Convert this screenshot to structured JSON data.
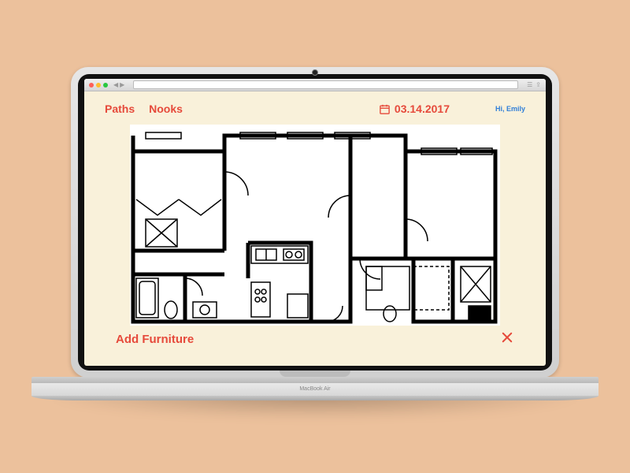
{
  "device_label": "MacBook Air",
  "tabs": {
    "paths": "Paths",
    "nooks": "Nooks"
  },
  "date": "03.14.2017",
  "greeting": "Hi, Emily",
  "actions": {
    "add_furniture": "Add Furniture"
  },
  "colors": {
    "accent": "#e64a3b",
    "link": "#2f7ed8",
    "canvas": "#f9f1da"
  }
}
